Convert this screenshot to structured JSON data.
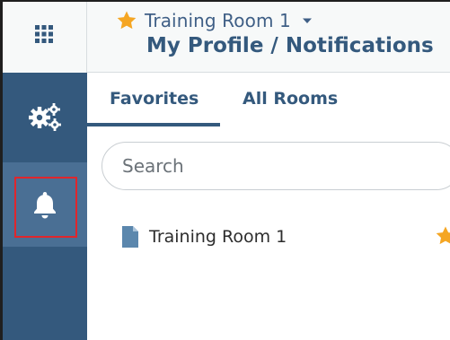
{
  "header": {
    "room_name": "Training Room 1",
    "page_title": "My Profile / Notifications"
  },
  "sidebar": {
    "items": [
      {
        "name": "settings",
        "icon": "gears-icon"
      },
      {
        "name": "notifications",
        "icon": "bell-icon",
        "active": true
      }
    ]
  },
  "tabs": [
    {
      "label": "Favorites",
      "active": true
    },
    {
      "label": "All Rooms",
      "active": false
    }
  ],
  "search": {
    "placeholder": "Search",
    "value": ""
  },
  "list": {
    "items": [
      {
        "label": "Training Room 1",
        "favorited": true
      }
    ]
  },
  "colors": {
    "brand": "#34597d",
    "sidebar_active": "#4a6f94",
    "star": "#f5a623",
    "highlight": "#e0262c"
  }
}
